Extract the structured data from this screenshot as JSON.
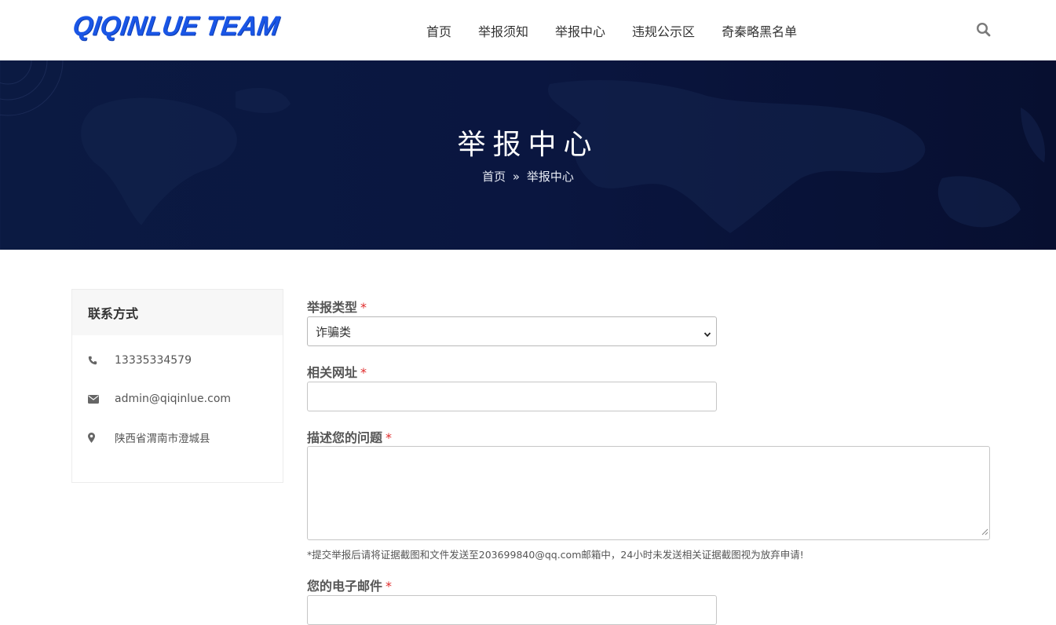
{
  "header": {
    "logo_text": "QIQINLUE TEAM",
    "nav": [
      "首页",
      "举报须知",
      "举报中心",
      "违规公示区",
      "奇秦略黑名单"
    ],
    "search_icon": "search-icon"
  },
  "banner": {
    "title": "举报中心",
    "breadcrumb": {
      "home": "首页",
      "separator": "»",
      "current": "举报中心"
    }
  },
  "sidebar": {
    "title": "联系方式",
    "phone": "13335334579",
    "email": "admin@qiqinlue.com",
    "address": "陕西省渭南市澄城县"
  },
  "form": {
    "required_mark": "*",
    "type_label": "举报类型",
    "type_value": "诈骗类",
    "url_label": "相关网址",
    "url_value": "",
    "desc_label": "描述您的问题",
    "desc_value": "",
    "hint": "*提交举报后请将证据截图和文件发送至203699840@qq.com邮箱中，24小时未发送相关证据截图视为放弃申请!",
    "email_label": "您的电子邮件"
  },
  "colors": {
    "brand": "#1a56e6",
    "banner_bg": "#0a1640",
    "required": "#e02b2b"
  }
}
